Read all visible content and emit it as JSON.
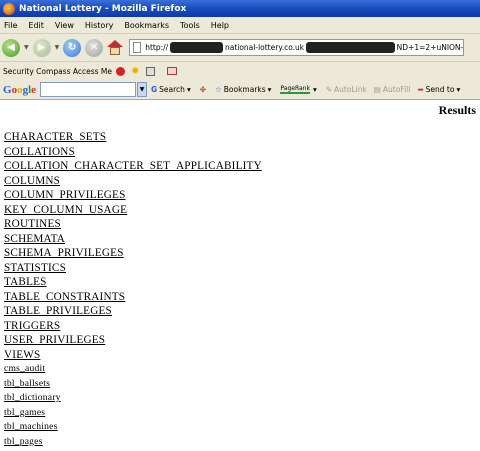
{
  "window": {
    "title": "National Lottery - Mozilla Firefox"
  },
  "menu": [
    "File",
    "Edit",
    "View",
    "History",
    "Bookmarks",
    "Tools",
    "Help"
  ],
  "nav": {
    "url_prefix": "http://",
    "url_middle": "national-lottery.co.uk",
    "url_suffix": "ND+1=2+uNION-"
  },
  "security_bar": {
    "label": "Security Compass Access Me"
  },
  "google_bar": {
    "search_label": "Search",
    "bookmarks_label": "Bookmarks",
    "pagerank_label": "PageRank",
    "autolink_label": "AutoLink",
    "autofill_label": "AutoFill",
    "sendto_label": "Send to"
  },
  "page": {
    "heading": "Results",
    "tables": [
      "CHARACTER_SETS",
      "COLLATIONS",
      "COLLATION_CHARACTER_SET_APPLICABILITY",
      "COLUMNS",
      "COLUMN_PRIVILEGES",
      "KEY_COLUMN_USAGE",
      "ROUTINES",
      "SCHEMATA",
      "SCHEMA_PRIVILEGES",
      "STATISTICS",
      "TABLES",
      "TABLE_CONSTRAINTS",
      "TABLE_PRIVILEGES",
      "TRIGGERS",
      "USER_PRIVILEGES",
      "VIEWS",
      "cms_audit",
      "tbl_ballsets",
      "tbl_dictionary",
      "tbl_games",
      "tbl_machines",
      "tbl_pages"
    ]
  }
}
